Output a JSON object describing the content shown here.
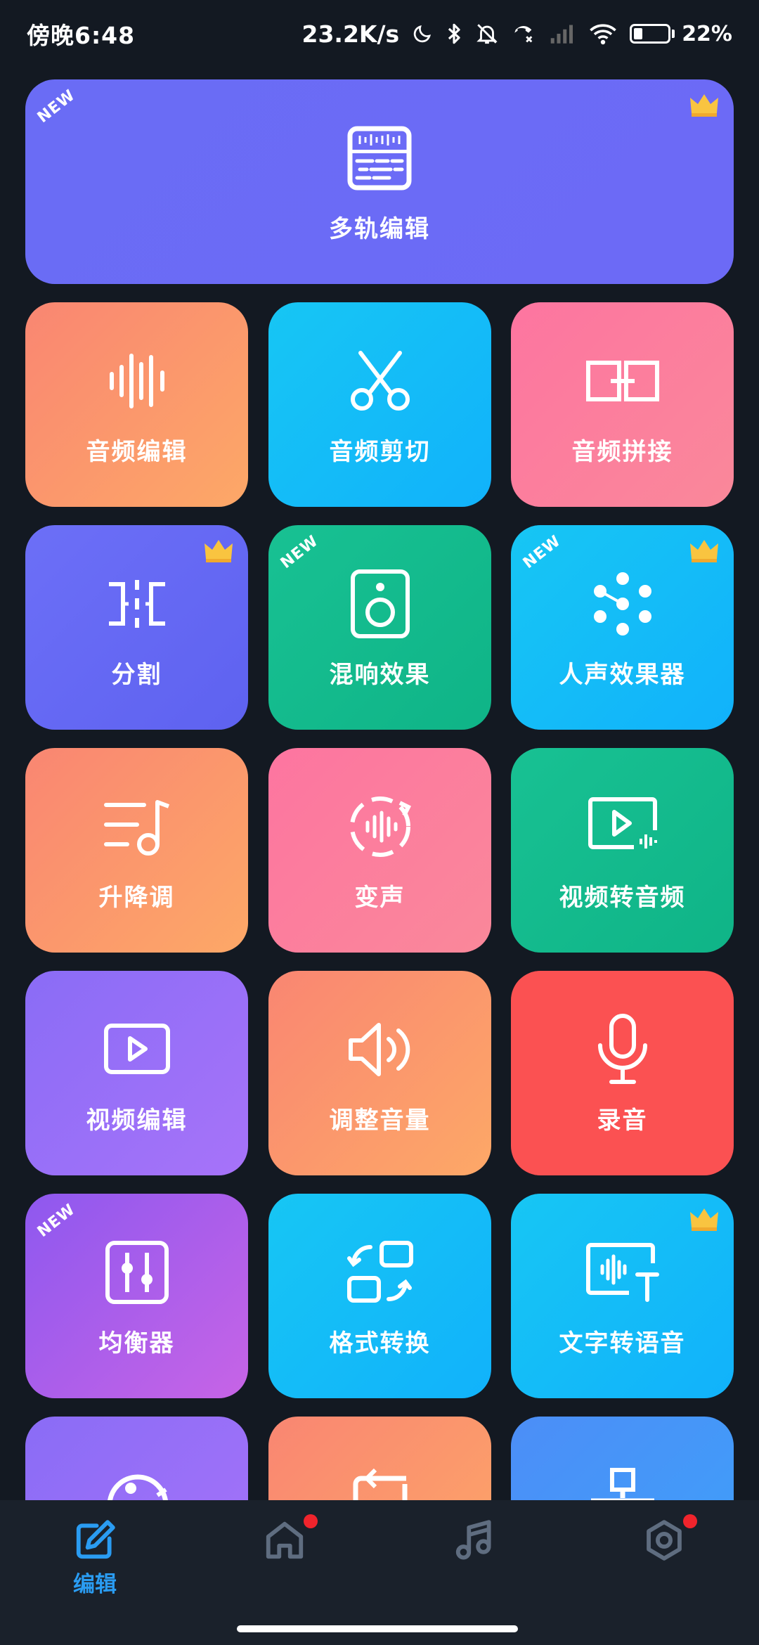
{
  "status_bar": {
    "time": "傍晚6:48",
    "net_speed": "23.2K/s",
    "battery": "22%"
  },
  "tools": [
    {
      "label": "多轨编辑",
      "new": "NEW",
      "crown": true
    },
    {
      "label": "音频编辑"
    },
    {
      "label": "音频剪切"
    },
    {
      "label": "音频拼接"
    },
    {
      "label": "分割",
      "crown": true
    },
    {
      "label": "混响效果",
      "new": "NEW"
    },
    {
      "label": "人声效果器",
      "new": "NEW",
      "crown": true
    },
    {
      "label": "升降调"
    },
    {
      "label": "变声"
    },
    {
      "label": "视频转音频"
    },
    {
      "label": "视频编辑"
    },
    {
      "label": "调整音量"
    },
    {
      "label": "录音"
    },
    {
      "label": "均衡器",
      "new": "NEW"
    },
    {
      "label": "格式转换"
    },
    {
      "label": "文字转语音",
      "crown": true
    }
  ],
  "new_badge": "NEW",
  "bottom_nav": {
    "edit_label": "编辑",
    "active_color": "#2a9cf2",
    "inactive_color": "#6b7a8c"
  },
  "icons": [
    "moon-icon",
    "bluetooth-icon",
    "bell-off-icon",
    "missed-call-icon",
    "signal-icon",
    "wifi-icon",
    "battery-icon",
    "crown-icon",
    "edit-icon",
    "home-icon",
    "music-icon",
    "settings-icon"
  ]
}
